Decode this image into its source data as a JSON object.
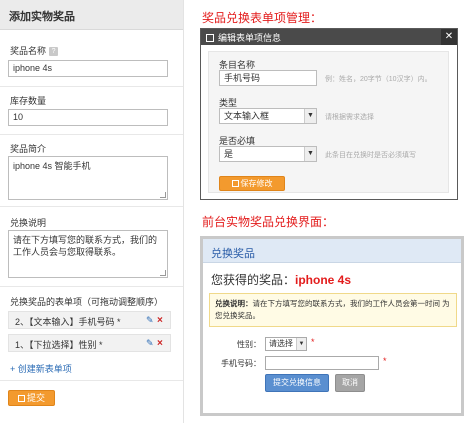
{
  "left_panel": {
    "title": "添加实物奖品",
    "name_label": "奖品名称",
    "help_badge": "?",
    "name_value": "iphone 4s",
    "stock_label": "库存数量",
    "stock_value": "10",
    "intro_label": "奖品简介",
    "intro_value": "iphone 4s 智能手机",
    "redeem_label": "兑换说明",
    "redeem_value": "请在下方填写您的联系方式，我们的工作人员会与您取得联系。",
    "form_items_label": "兑换奖品的表单项（可拖动调整顺序）",
    "form_items": [
      {
        "text": "2、【文本输入】手机号码 *"
      },
      {
        "text": "1、【下拉选择】性别 *"
      }
    ],
    "create_link": "创建新表单项",
    "submit": "提交"
  },
  "management": {
    "section_title": "奖品兑换表单项管理：",
    "modal_title": "编辑表单项信息",
    "close": "✕",
    "item_name_label": "条目名称",
    "item_name_value": "手机号码",
    "item_name_hint": "例：姓名，20字节（10汉字）内。",
    "type_label": "类型",
    "type_value": "文本输入框",
    "type_hint": "请根据需求选择",
    "required_label": "是否必填",
    "required_value": "是",
    "required_hint": "此条目在兑换时是否必须填写",
    "save": "保存修改"
  },
  "frontend": {
    "section_title": "前台实物奖品兑换界面：",
    "header": "兑换奖品",
    "prize_prefix": "您获得的奖品：",
    "prize_name": "iphone 4s",
    "notice_label": "兑换说明：",
    "notice_text": "请在下方填写您的联系方式，我们的工作人员会第一时间 为您兑换奖品。",
    "gender_label": "性别：",
    "gender_value": "请选择",
    "phone_label": "手机号码：",
    "submit": "提交兑换信息",
    "cancel": "取消",
    "required_mark": "*"
  },
  "colors": {
    "accent_orange": "#f39a2e",
    "title_red": "#e31c1c",
    "link_blue": "#2a6bb5"
  }
}
